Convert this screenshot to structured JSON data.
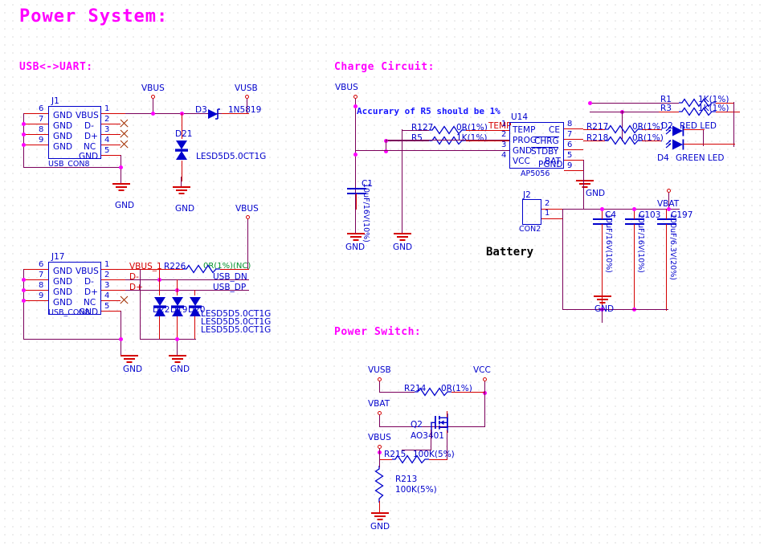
{
  "sheet": {
    "title": "Power System:",
    "sections": [
      {
        "id": "usb-uart",
        "label": "USB<->UART:"
      },
      {
        "id": "charge",
        "label": "Charge Circuit:"
      },
      {
        "id": "power-switch",
        "label": "Power Switch:"
      }
    ],
    "note": "Accurary of R5 should be 1%"
  },
  "usb_uart": {
    "j1": {
      "ref": "J1",
      "value": "USB_CON8",
      "left_pins": [
        {
          "num": "6",
          "name": "GND"
        },
        {
          "num": "7",
          "name": "GND"
        },
        {
          "num": "8",
          "name": "GND"
        },
        {
          "num": "9",
          "name": "GND"
        }
      ],
      "right_pins": [
        {
          "num": "1",
          "name": "VBUS"
        },
        {
          "num": "2",
          "name": "D-"
        },
        {
          "num": "3",
          "name": "D+"
        },
        {
          "num": "4",
          "name": "NC"
        },
        {
          "num": "5",
          "name": "GND"
        }
      ]
    },
    "j17": {
      "ref": "J17",
      "value": "USB_CON8",
      "left_pins": [
        {
          "num": "6",
          "name": "GND"
        },
        {
          "num": "7",
          "name": "GND"
        },
        {
          "num": "8",
          "name": "GND"
        },
        {
          "num": "9",
          "name": "GND"
        }
      ],
      "right_pins": [
        {
          "num": "1",
          "name": "VBUS"
        },
        {
          "num": "2",
          "name": "D-"
        },
        {
          "num": "3",
          "name": "D+"
        },
        {
          "num": "4",
          "name": "NC"
        },
        {
          "num": "5",
          "name": "GND"
        }
      ]
    },
    "d3": {
      "ref": "D3",
      "value": "1N5819"
    },
    "d21": {
      "ref": "D21",
      "value": "LESD5D5.0CT1G"
    },
    "d22": {
      "ref": "D22",
      "value": "LESD5D5.0CT1G"
    },
    "d19": {
      "ref": "D19",
      "value": "LESD5D5.0CT1G"
    },
    "d20": {
      "ref": "D20",
      "value": "LESD5D5.0CT1G"
    },
    "r226": {
      "ref": "R226",
      "value": "0R(1%)(NC)"
    },
    "nets": {
      "vbus_top": "VBUS",
      "vusb": "VUSB",
      "vbus_mid": "VBUS",
      "vbus_1": "VBUS_1",
      "dminus": "D-",
      "dplus": "D+",
      "usb_dn": "USB_DN",
      "usb_dp": "USB_DP"
    },
    "gnd_labels": [
      "GND",
      "GND",
      "GND",
      "GND"
    ]
  },
  "charge": {
    "u14": {
      "ref": "U14",
      "value": "AP5056",
      "left_pins": [
        {
          "num": "1",
          "name": "TEMP",
          "bar": false
        },
        {
          "num": "2",
          "name": "PROG",
          "bar": false
        },
        {
          "num": "3",
          "name": "GND",
          "bar": false
        },
        {
          "num": "4",
          "name": "VCC",
          "bar": false
        }
      ],
      "right_pins": [
        {
          "num": "8",
          "name": "CE",
          "bar": false
        },
        {
          "num": "7",
          "name": "CHRG",
          "bar": true
        },
        {
          "num": "6",
          "name": "STDBY",
          "bar": true
        },
        {
          "num": "5",
          "name": "BAT",
          "bar": false
        },
        {
          "num": "9",
          "name": "PGND",
          "bar": false
        }
      ]
    },
    "r127": {
      "ref": "R127",
      "value": "0R(1%)"
    },
    "r5": {
      "ref": "R5",
      "value": "1K(1%)"
    },
    "r1": {
      "ref": "R1",
      "value": "1K(1%)"
    },
    "r3": {
      "ref": "R3",
      "value": "1K(1%)"
    },
    "r217": {
      "ref": "R217",
      "value": "0R(1%)"
    },
    "r218": {
      "ref": "R218",
      "value": "0R(1%)"
    },
    "c1": {
      "ref": "C1",
      "value": "10uF/16V(10%)"
    },
    "c4": {
      "ref": "C4",
      "value": "10uF/16V(10%)"
    },
    "c103": {
      "ref": "C103",
      "value": "10uF/16V(10%)"
    },
    "c197": {
      "ref": "C197",
      "value": "100uF/6.3V(20%)"
    },
    "d2": {
      "ref": "D2",
      "value": "RED LED"
    },
    "d4": {
      "ref": "D4",
      "value": "GREEN LED"
    },
    "j2": {
      "ref": "J2",
      "value": "CON2",
      "caption": "Battery",
      "pins": [
        {
          "num": "2"
        },
        {
          "num": "1"
        }
      ]
    },
    "nets": {
      "vbus": "VBUS",
      "temp": "TEMP",
      "vbat": "VBAT"
    },
    "gnd_labels": [
      "GND",
      "GND",
      "GND",
      "GND"
    ]
  },
  "power_switch": {
    "r214": {
      "ref": "R214",
      "value": "0R(1%)"
    },
    "r215": {
      "ref": "R215",
      "value": "100K(5%)"
    },
    "r213": {
      "ref": "R213",
      "value": "100K(5%)"
    },
    "q2": {
      "ref": "Q2",
      "value": "AO3401"
    },
    "nets": {
      "vusb": "VUSB",
      "vcc": "VCC",
      "vbat": "VBAT",
      "vbus": "VBUS"
    },
    "gnd_labels": [
      "GND"
    ]
  },
  "colors": {
    "title": "#ff00ff",
    "net_wire": "#7b005b",
    "pin_wire": "#d40000",
    "symbol": "#0000cc",
    "junction": "#ff00ff",
    "note": "#1414ff",
    "green_value": "#00912b",
    "background": "#ffffff"
  }
}
